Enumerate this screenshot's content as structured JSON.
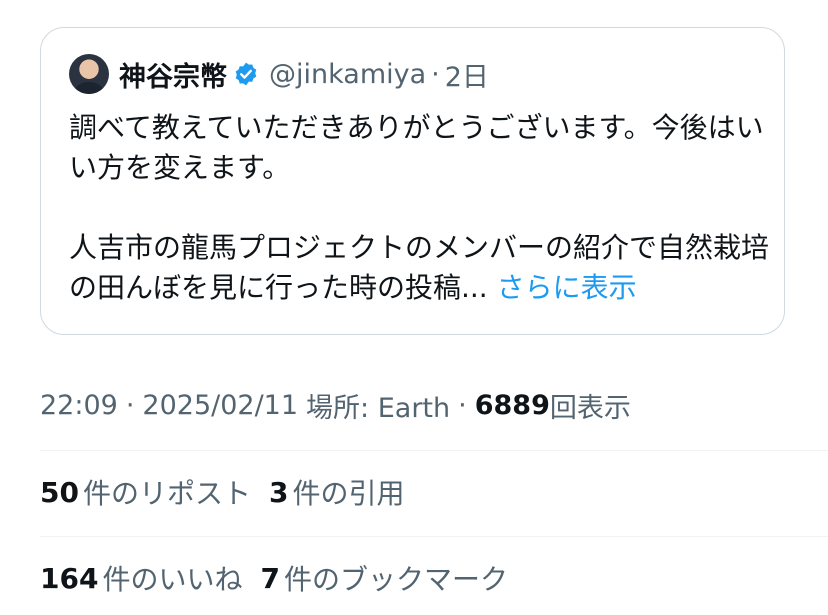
{
  "quoted_post": {
    "author_name": "神谷宗幣",
    "handle": "@jinkamiya",
    "separator": "·",
    "age": "2日",
    "paragraph1": "調べて教えていただきありがとうございます。今後はいい方を変えます。",
    "paragraph2": "人吉市の龍馬プロジェクトのメンバーの紹介で自然栽培の田んぼを見に行った時の投稿...",
    "show_more": "さらに表示"
  },
  "meta": {
    "time": "22:09",
    "sep1": "·",
    "date": "2025/02/11",
    "location_label": "場所: Earth",
    "sep2": "·",
    "views_count": "6889",
    "views_label": "回表示"
  },
  "stats": {
    "reposts_count": "50",
    "reposts_label": "件のリポスト",
    "quotes_count": "3",
    "quotes_label": "件の引用",
    "likes_count": "164",
    "likes_label": "件のいいね",
    "bookmarks_count": "7",
    "bookmarks_label": "件のブックマーク"
  },
  "colors": {
    "accent": "#1d9bf0",
    "muted_text": "#536471",
    "border": "#cfd9de",
    "verified": "#1d9bf0"
  }
}
